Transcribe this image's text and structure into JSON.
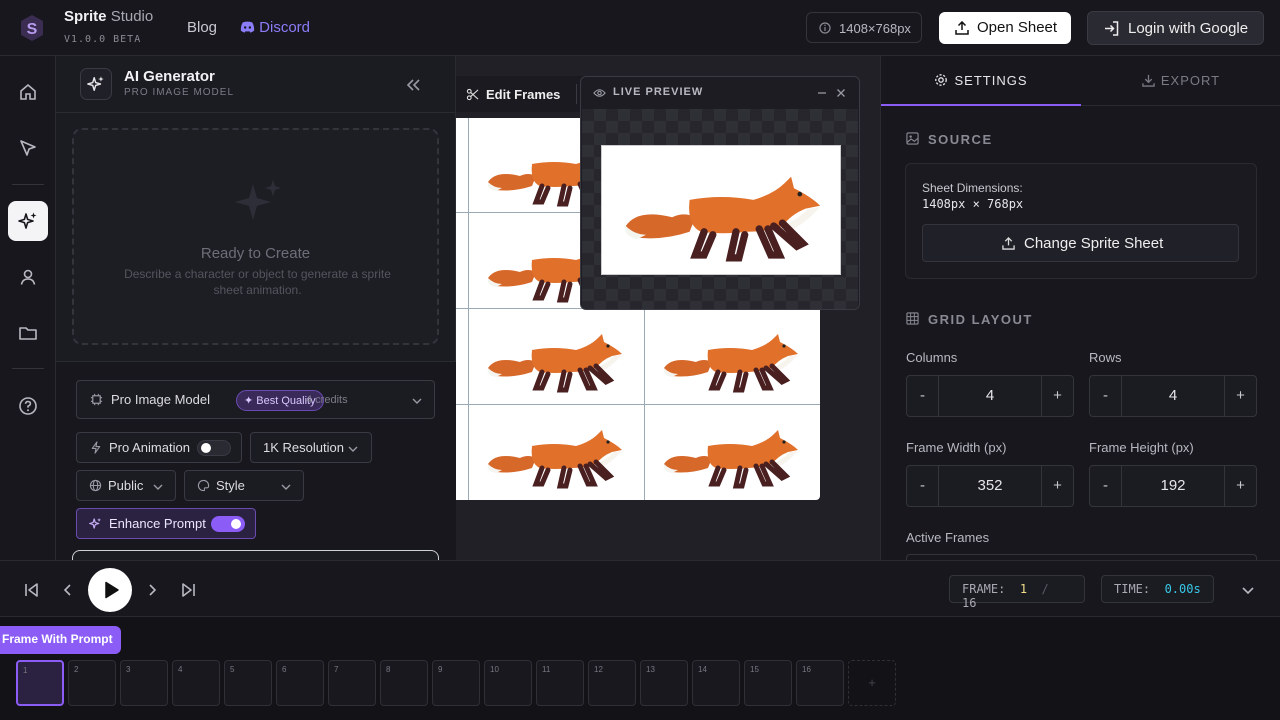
{
  "header": {
    "brand_main": "Sprite",
    "brand_sub": "Studio",
    "version": "V1.0.0 BETA",
    "nav_blog": "Blog",
    "nav_discord": "Discord",
    "dimensions": "1408×768px",
    "open_sheet": "Open Sheet",
    "login": "Login with Google"
  },
  "rail": {
    "icons": [
      "home-icon",
      "cursor-icon",
      "sparkles-icon",
      "user-icon",
      "folder-icon",
      "help-icon"
    ],
    "active": "sparkles-icon"
  },
  "generator": {
    "title": "AI Generator",
    "subtitle": "PRO IMAGE MODEL",
    "empty_title": "Ready to Create",
    "empty_desc": "Describe a character or object to generate a sprite sheet animation.",
    "model_label": "Pro Image Model",
    "model_badge": "✦ Best Quality",
    "model_credits": "4 credits",
    "pro_animation": "Pro Animation",
    "pro_animation_on": false,
    "resolution": "1K Resolution",
    "visibility": "Public",
    "style": "Style",
    "enhance_prompt": "Enhance Prompt",
    "enhance_on": true
  },
  "canvas": {
    "edit_frames": "Edit Frames"
  },
  "preview": {
    "title": "LIVE PREVIEW"
  },
  "settings": {
    "tab_settings": "SETTINGS",
    "tab_export": "EXPORT",
    "source_title": "SOURCE",
    "sheet_dims_label": "Sheet Dimensions:",
    "sheet_dims_value": "1408px × 768px",
    "change_sheet": "Change Sprite Sheet",
    "grid_title": "GRID LAYOUT",
    "columns_label": "Columns",
    "columns": "4",
    "rows_label": "Rows",
    "rows": "4",
    "frame_width_label": "Frame Width (px)",
    "frame_width": "352",
    "frame_height_label": "Frame Height (px)",
    "frame_height": "192",
    "active_frames_label": "Active Frames"
  },
  "player": {
    "frame_label": "FRAME:",
    "frame_current": "1",
    "frame_sep": "/",
    "frame_total": "16",
    "time_label": "TIME:",
    "time_value": "0.00s"
  },
  "timeline": {
    "frame_with_prompt": "Frame With Prompt",
    "frames": [
      "1",
      "2",
      "3",
      "4",
      "5",
      "6",
      "7",
      "8",
      "9",
      "10",
      "11",
      "12",
      "13",
      "14",
      "15",
      "16"
    ],
    "add": "+"
  },
  "colors": {
    "accent": "#8b5cf6",
    "discord": "#8b7cf8",
    "frame_current": "#f1e08a",
    "time_value": "#38c9e8"
  }
}
